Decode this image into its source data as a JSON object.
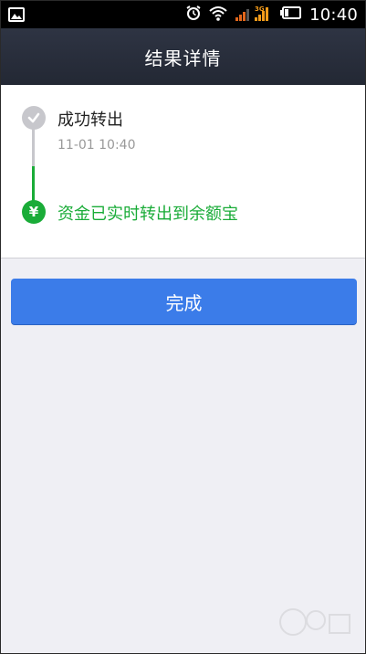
{
  "status_bar": {
    "time": "10:40",
    "network_label": "3G",
    "icons": [
      "gallery-icon",
      "alarm-icon",
      "wifi-icon",
      "signal-icon",
      "battery-icon"
    ]
  },
  "header": {
    "title": "结果详情"
  },
  "steps": [
    {
      "title": "成功转出",
      "time": "11-01 10:40",
      "icon": "check-icon"
    },
    {
      "title": "资金已实时转出到余额宝",
      "icon": "yen-icon",
      "symbol": "¥"
    }
  ],
  "done_button": {
    "label": "完成"
  },
  "colors": {
    "header_bg": "#2a2f3c",
    "success_green": "#1aac38",
    "button_blue": "#3b7ce9",
    "page_bg": "#efeff4"
  }
}
